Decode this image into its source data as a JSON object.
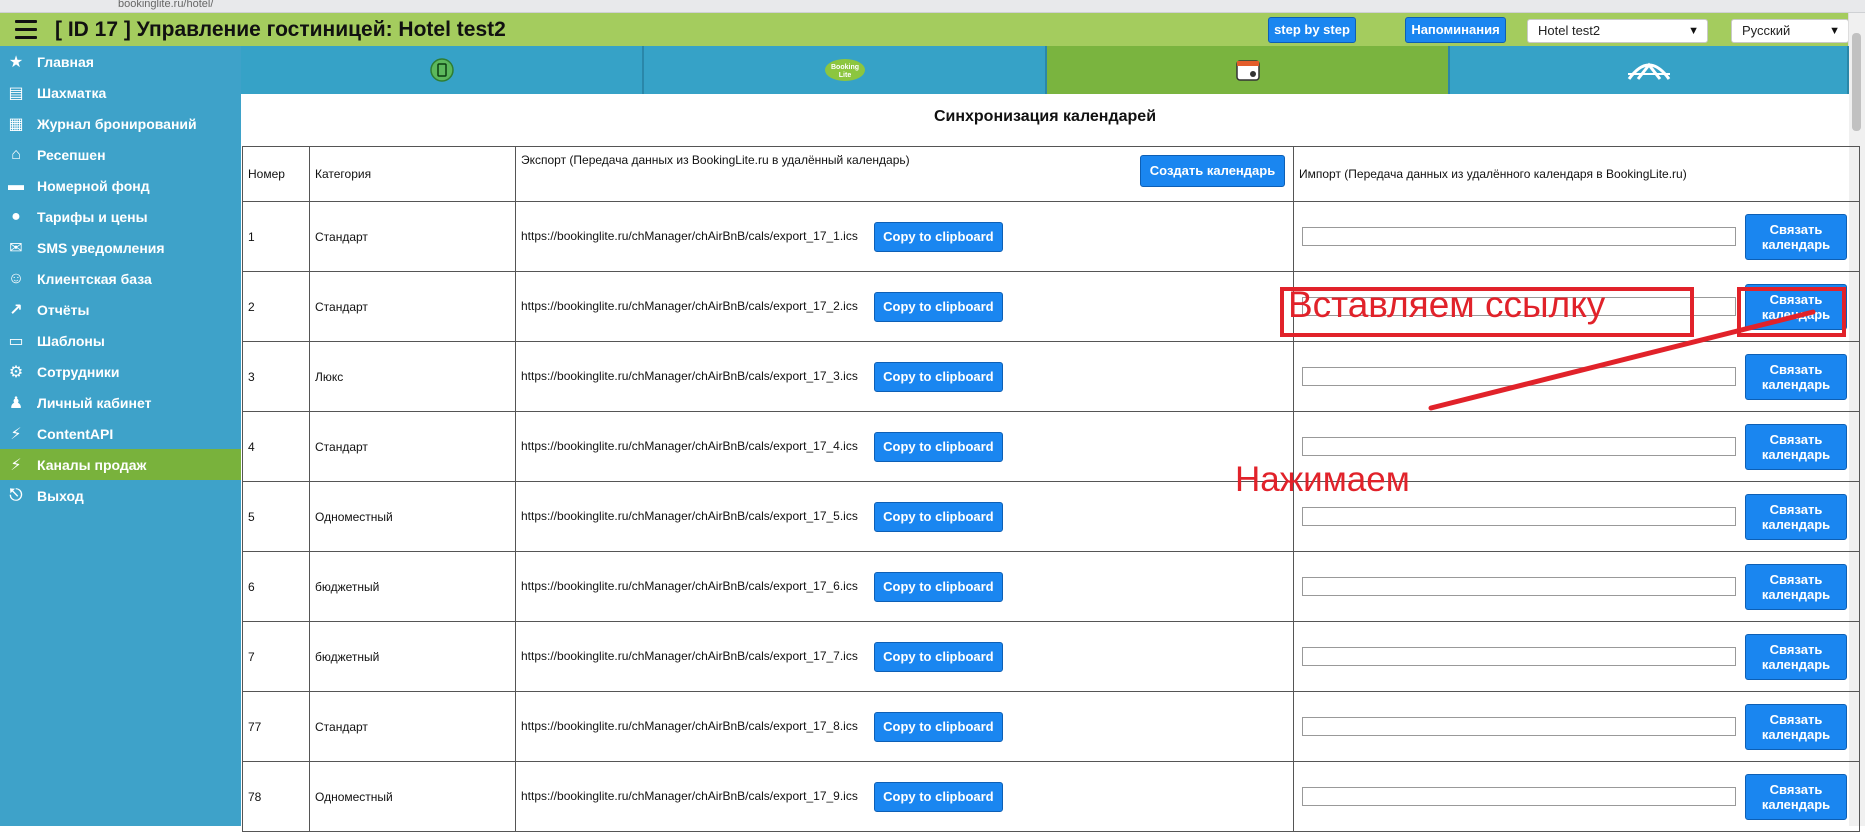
{
  "browser": {
    "url_fragment": "bookinglite.ru/hotel/"
  },
  "header": {
    "title": "[ ID 17 ] Управление гостиницей: Hotel test2",
    "step_button": "step by step",
    "reminders_button": "Напоминания",
    "hotel_select": "Hotel test2",
    "language_select": "Русский"
  },
  "sidebar": {
    "items": [
      {
        "label": "Главная",
        "icon": "star-icon"
      },
      {
        "label": "Шахматка",
        "icon": "grid-icon"
      },
      {
        "label": "Журнал бронирований",
        "icon": "book-icon"
      },
      {
        "label": "Ресепшен",
        "icon": "reception-icon"
      },
      {
        "label": "Номерной фонд",
        "icon": "bed-icon"
      },
      {
        "label": "Тарифы и цены",
        "icon": "coins-icon"
      },
      {
        "label": "SMS уведомления",
        "icon": "sms-icon"
      },
      {
        "label": "Клиентская база",
        "icon": "client-icon"
      },
      {
        "label": "Отчёты",
        "icon": "chart-icon"
      },
      {
        "label": "Шаблоны",
        "icon": "template-icon"
      },
      {
        "label": "Сотрудники",
        "icon": "gear-icon"
      },
      {
        "label": "Личный кабинет",
        "icon": "user-icon"
      },
      {
        "label": "ContentAPI",
        "icon": "api-icon"
      },
      {
        "label": "Каналы продаж",
        "icon": "channels-icon",
        "active": true
      },
      {
        "label": "Выход",
        "icon": "exit-icon"
      }
    ]
  },
  "tabs": [
    {
      "name": "tab-channel-1",
      "icon": "green-circle-icon",
      "active": false
    },
    {
      "name": "tab-bookinglite",
      "icon": "bookinglite-logo-icon",
      "logo_text": "Booking Lite",
      "active": false
    },
    {
      "name": "tab-calendar-sync",
      "icon": "calendar-icon",
      "active": true
    },
    {
      "name": "tab-channel-4",
      "icon": "arch-logo-icon",
      "active": false
    }
  ],
  "section": {
    "title": "Синхронизация календарей"
  },
  "table": {
    "headers": {
      "number": "Номер",
      "category": "Категория",
      "export": "Экспорт (Передача данных из BookingLite.ru в удалённый календарь)",
      "import": "Импорт (Передача данных из удалённого календаря в BookingLite.ru)"
    },
    "create_button": "Создать календарь",
    "copy_label": "Copy to clipboard",
    "link_label": "Связать календарь",
    "rows": [
      {
        "number": "1",
        "category": "Стандарт",
        "url": "https://bookinglite.ru/chManager/chAirBnB/cals/export_17_1.ics"
      },
      {
        "number": "2",
        "category": "Стандарт",
        "url": "https://bookinglite.ru/chManager/chAirBnB/cals/export_17_2.ics"
      },
      {
        "number": "3",
        "category": "Люкс",
        "url": "https://bookinglite.ru/chManager/chAirBnB/cals/export_17_3.ics"
      },
      {
        "number": "4",
        "category": "Стандарт",
        "url": "https://bookinglite.ru/chManager/chAirBnB/cals/export_17_4.ics"
      },
      {
        "number": "5",
        "category": "Одноместный",
        "url": "https://bookinglite.ru/chManager/chAirBnB/cals/export_17_5.ics"
      },
      {
        "number": "6",
        "category": "бюджетный",
        "url": "https://bookinglite.ru/chManager/chAirBnB/cals/export_17_6.ics"
      },
      {
        "number": "7",
        "category": "бюджетный",
        "url": "https://bookinglite.ru/chManager/chAirBnB/cals/export_17_7.ics"
      },
      {
        "number": "77",
        "category": "Стандарт",
        "url": "https://bookinglite.ru/chManager/chAirBnB/cals/export_17_8.ics"
      },
      {
        "number": "78",
        "category": "Одноместный",
        "url": "https://bookinglite.ru/chManager/chAirBnB/cals/export_17_9.ics"
      }
    ]
  },
  "annotations": {
    "paste_link": "Вставляем ссылку",
    "click": "Нажимаем",
    "color": "#e1222a"
  },
  "colors": {
    "header_bg": "#a4cc5e",
    "sidebar_bg": "#3ea2c9",
    "active_bg": "#79b23c",
    "button_blue": "#1a86f0"
  }
}
